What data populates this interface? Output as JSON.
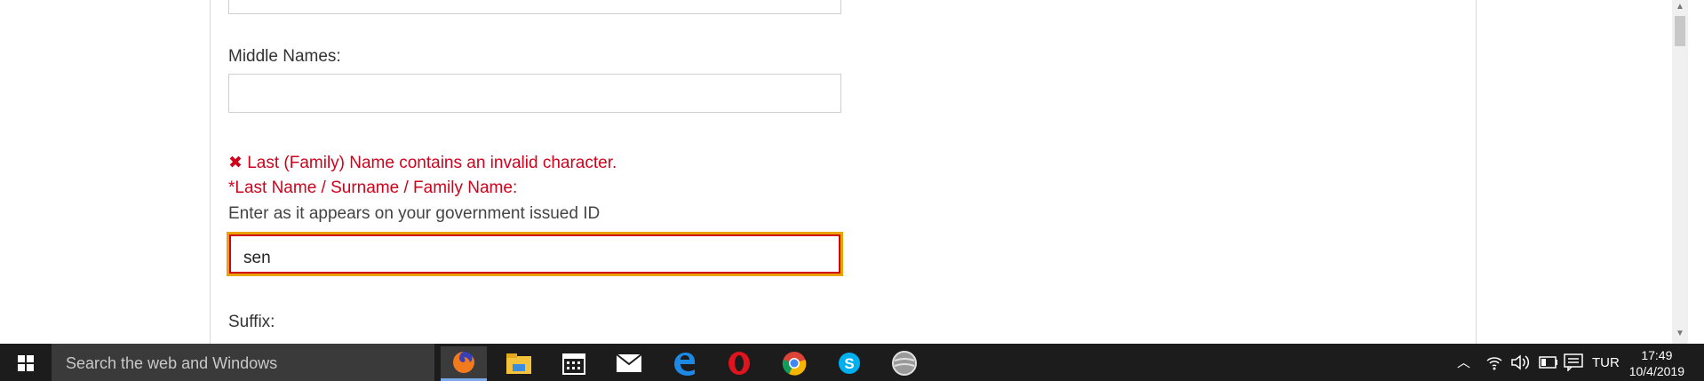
{
  "form": {
    "middle_names_label": "Middle Names:",
    "last_name_error": "✖ Last (Family) Name contains an invalid character.",
    "last_name_label": "*Last Name / Surname / Family Name:",
    "last_name_hint": "Enter as it appears on your government issued ID",
    "last_name_value": "sen",
    "suffix_label": "Suffix:"
  },
  "colors": {
    "error": "#d0021b",
    "focus_outline": "#e8a300"
  },
  "taskbar": {
    "search_placeholder": "Search the web and Windows",
    "apps": [
      "firefox-icon",
      "file-explorer-icon",
      "calendar-icon",
      "mail-icon",
      "edge-icon",
      "opera-icon",
      "chrome-icon",
      "skype-icon",
      "google-earth-pro-icon"
    ],
    "language": "TUR",
    "time": "17:49",
    "date": "10/4/2019"
  }
}
